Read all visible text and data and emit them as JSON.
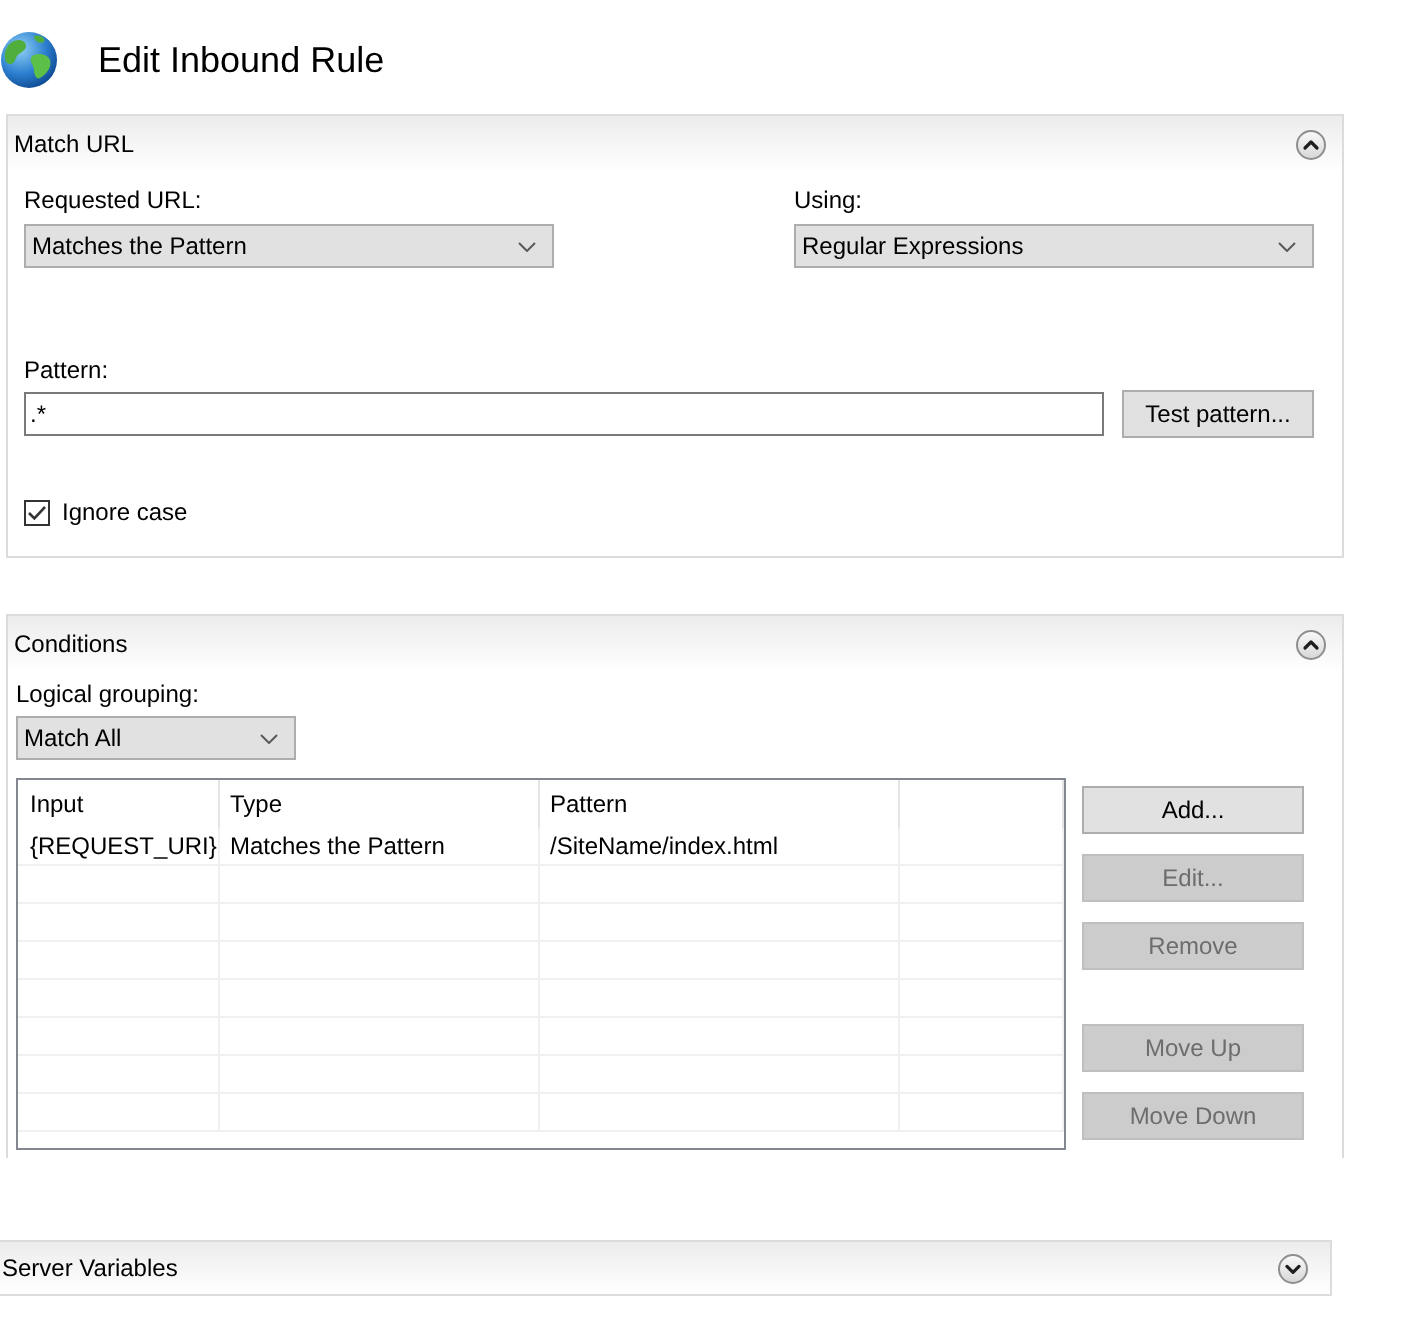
{
  "header": {
    "title": "Edit Inbound Rule"
  },
  "match_url": {
    "title": "Match URL",
    "expanded": true,
    "requested_url": {
      "label": "Requested URL:",
      "value": "Matches the Pattern"
    },
    "using": {
      "label": "Using:",
      "value": "Regular Expressions"
    },
    "pattern": {
      "label": "Pattern:",
      "value": ".*"
    },
    "test_pattern_button": {
      "label": "Test pattern..."
    },
    "ignore_case": {
      "label": "Ignore case",
      "checked": true
    }
  },
  "conditions": {
    "title": "Conditions",
    "expanded": true,
    "logical_grouping": {
      "label": "Logical grouping:",
      "value": "Match All"
    },
    "table": {
      "columns": [
        "Input",
        "Type",
        "Pattern"
      ],
      "rows": [
        [
          "{REQUEST_URI}",
          "Matches the Pattern",
          "/SiteName/index.html"
        ]
      ]
    },
    "button_groups": [
      [
        {
          "label": "Add...",
          "disabled": false
        },
        {
          "label": "Edit...",
          "disabled": true
        },
        {
          "label": "Remove",
          "disabled": true
        }
      ],
      [
        {
          "label": "Move Up",
          "disabled": true
        },
        {
          "label": "Move Down",
          "disabled": true
        }
      ]
    ]
  },
  "server_variables": {
    "title": "Server Variables",
    "expanded": false
  }
}
